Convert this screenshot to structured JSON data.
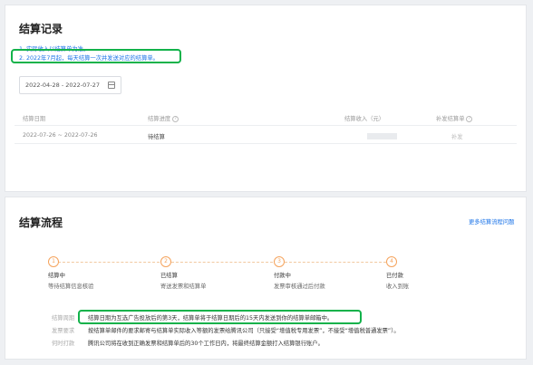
{
  "records": {
    "title": "结算记录",
    "notes": [
      "1. 实际收入以结算单为准。",
      "2. 2022年7月起，每天结算一次并发送对应的结算单。"
    ],
    "date_range": "2022-04-28 - 2022-07-27",
    "table": {
      "headers": {
        "date": "结算日期",
        "progress": "结算进度",
        "income": "结算收入（元）",
        "reissue": "补发结算单"
      },
      "rows": [
        {
          "date": "2022-07-26 ~ 2022-07-26",
          "progress": "待结算",
          "income": "",
          "reissue": "补发"
        }
      ]
    }
  },
  "flow": {
    "title": "结算流程",
    "more_link": "更多结算流程问题",
    "steps": [
      {
        "num": "1",
        "label": "结算中",
        "desc": "等待结算信息核验"
      },
      {
        "num": "2",
        "label": "已结算",
        "desc": "寄送发票和结算单"
      },
      {
        "num": "3",
        "label": "付款中",
        "desc": "发票审核通过后付款"
      },
      {
        "num": "4",
        "label": "已付款",
        "desc": "收入到账"
      }
    ],
    "requirements": [
      {
        "label": "结算周期",
        "text": "结算日期为互选广告投放后的第3天，结算单将于结算日期后的15天内发送到你的结算单邮箱中。"
      },
      {
        "label": "发票要求",
        "text": "按结算单邮件的要求邮寄与结算单实际收入等额的发票给腾讯公司（只接受“增值税专用发票”，不接受“增值税普通发票”）。"
      },
      {
        "label": "何时打款",
        "text": "腾讯公司将在收到正确发票和结算单后的30个工作日内，将最终结算金额打入结算银行账户。"
      }
    ]
  },
  "colors": {
    "highlight": "#12b24a",
    "accent_orange": "#f5a35c",
    "link_blue": "#1a73e8"
  }
}
